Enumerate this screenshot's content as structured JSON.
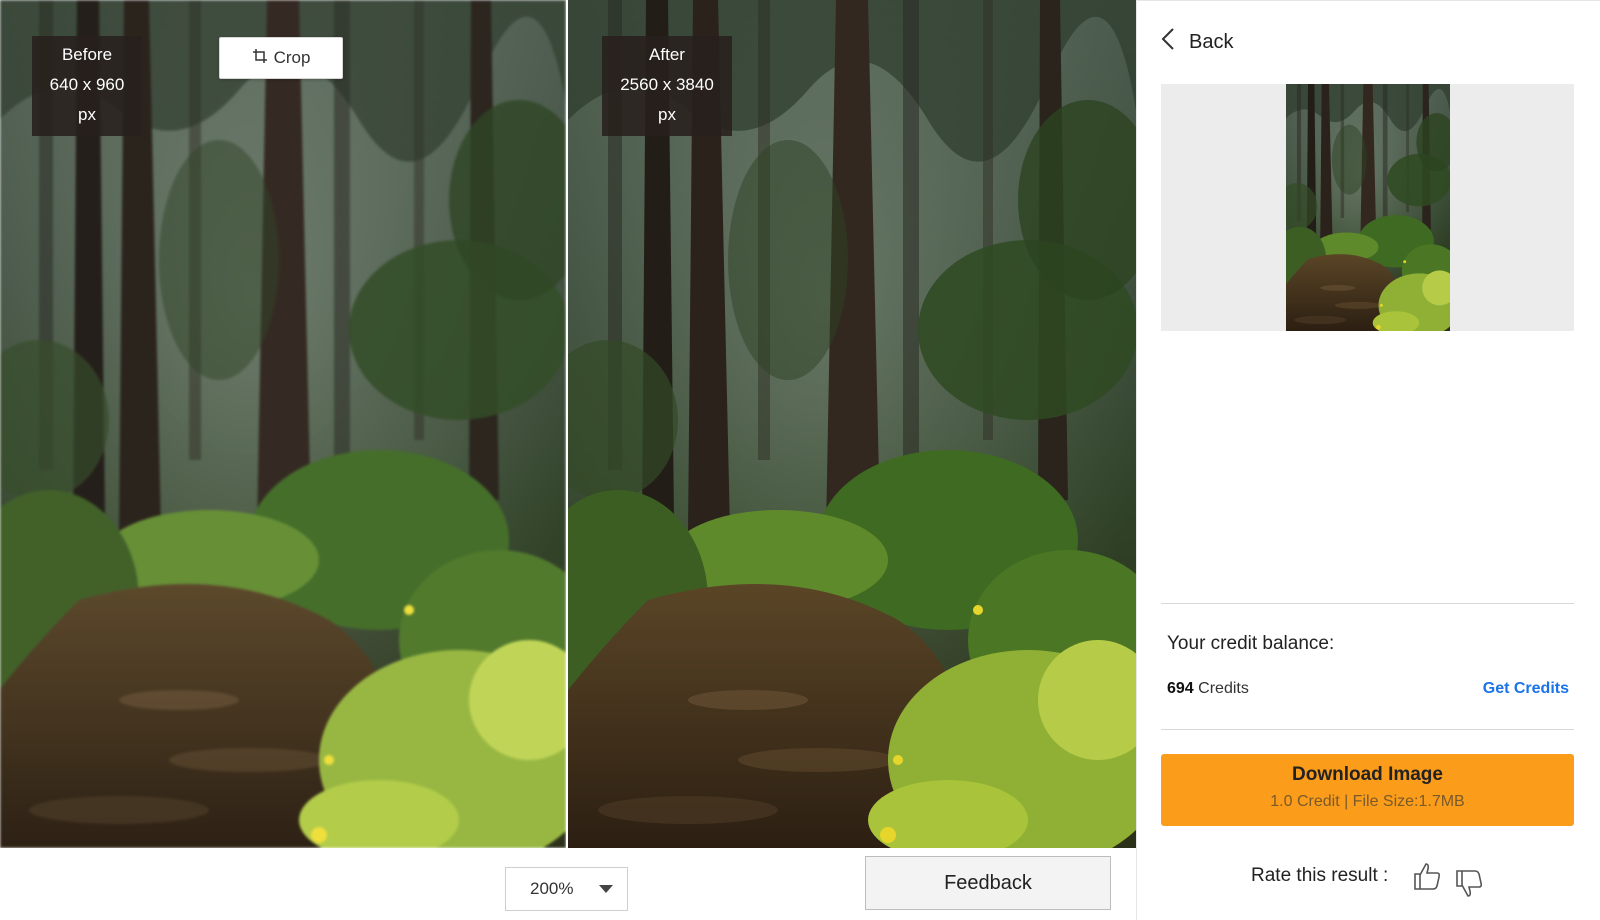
{
  "before": {
    "label": "Before",
    "size": "640 x 960 px"
  },
  "after": {
    "label": "After",
    "size": "2560 x 3840 px"
  },
  "crop": {
    "label": "Crop",
    "icon": "crop-icon"
  },
  "zoom": {
    "value": "200%",
    "icon": "caret-down-icon"
  },
  "feedback": {
    "label": "Feedback"
  },
  "panel": {
    "back_label": "Back",
    "back_icon": "chevron-left-icon",
    "credit_title": "Your credit balance:",
    "credit_count": "694",
    "credit_unit": "Credits",
    "get_credits": "Get Credits",
    "download_title": "Download Image",
    "download_sub": "1.0 Credit | File Size:1.7MB",
    "rate_label": "Rate this result :",
    "thumb_up_icon": "thumbs-up-icon",
    "thumb_down_icon": "thumbs-down-icon"
  },
  "colors": {
    "accent": "#fb9c1a",
    "link": "#1a73e8",
    "badge_bg": "#28201c"
  }
}
